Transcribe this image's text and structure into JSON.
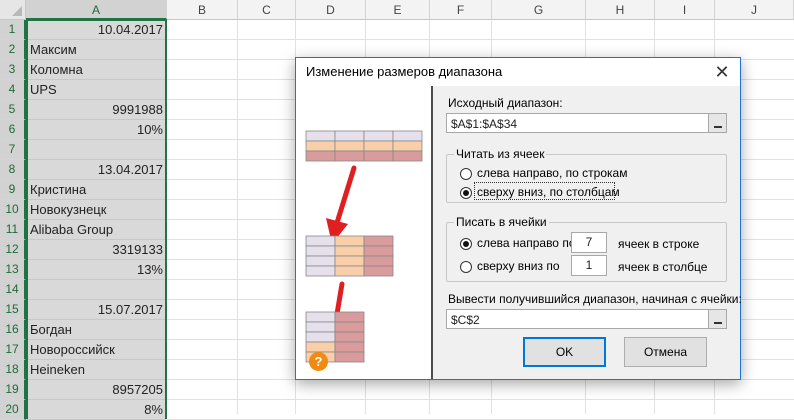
{
  "sheet": {
    "columns": [
      "A",
      "B",
      "C",
      "D",
      "E",
      "F",
      "G",
      "H",
      "I",
      "J"
    ],
    "selected_column": "A",
    "rows": [
      "1",
      "2",
      "3",
      "4",
      "5",
      "6",
      "7",
      "8",
      "9",
      "10",
      "11",
      "12",
      "13",
      "14",
      "15",
      "16",
      "17",
      "18",
      "19",
      "20"
    ],
    "cells_A": [
      "10.04.2017",
      "Максим",
      "Коломна",
      "UPS",
      "9991988",
      "10%",
      "",
      "13.04.2017",
      "Кристина",
      "Новокузнецк",
      "Alibaba Group",
      "3319133",
      "13%",
      "",
      "15.07.2017",
      "Богдан",
      "Новороссийск",
      "Heineken",
      "8957205",
      "8%"
    ],
    "align_right": [
      true,
      false,
      false,
      false,
      true,
      true,
      false,
      true,
      false,
      false,
      false,
      true,
      true,
      false,
      true,
      false,
      false,
      false,
      true,
      true
    ]
  },
  "dialog": {
    "title": "Изменение размеров диапазона",
    "close_glyph": "✕",
    "source_label": "Исходный диапазон:",
    "source_value": "$A$1:$A$34",
    "read_group": {
      "title": "Читать из ячеек",
      "option1": "слева направо, по строкам",
      "option2": "сверху вниз, по столбцам",
      "selected": 2
    },
    "write_group": {
      "title": "Писать в ячейки",
      "option1": "слева направо по",
      "option1_value": "7",
      "option1_suffix": "ячеек в строке",
      "option2": "сверху вниз по",
      "option2_value": "1",
      "option2_suffix": "ячеек в столбце",
      "selected": 1
    },
    "output_label": "Вывести получившийся диапазон, начиная с ячейки:",
    "output_value": "$C$2",
    "ok_label": "OK",
    "cancel_label": "Отмена",
    "help_glyph": "?"
  },
  "colors": {
    "accent": "#217346",
    "selection_fill": "#d9d9d9",
    "dialog_border": "#1f74cf",
    "help": "#f08a10",
    "diagram_light": "#e6e0ec",
    "diagram_peach": "#f9cfaa",
    "diagram_rose": "#d99b9b",
    "arrow": "#e02020"
  }
}
